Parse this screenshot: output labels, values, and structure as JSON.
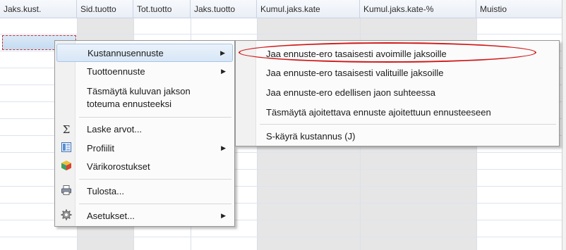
{
  "columns": [
    "Jaks.kust.",
    "Sid.tuotto",
    "Tot.tuotto",
    "Jaks.tuotto",
    "Kumul.jaks.kate",
    "Kumul.jaks.kate-%",
    "Muistio"
  ],
  "context_menu": {
    "items": [
      {
        "label": "Kustannusennuste",
        "icon": "",
        "submenu": true
      },
      {
        "label": "Tuottoennuste",
        "icon": "",
        "submenu": true
      },
      {
        "label": "Täsmäytä kuluvan jakson toteuma ennusteeksi",
        "line1": "Täsmäytä kuluvan jakson",
        "line2": "toteuma ennusteeksi",
        "icon": "",
        "submenu": false
      },
      {
        "label": "Laske arvot...",
        "icon": "sigma-icon",
        "submenu": false
      },
      {
        "label": "Profiilit",
        "icon": "profile-icon",
        "submenu": true
      },
      {
        "label": "Värikorostukset",
        "icon": "color-cube-icon",
        "submenu": false
      },
      {
        "label": "Tulosta...",
        "icon": "printer-icon",
        "submenu": false
      },
      {
        "label": "Asetukset...",
        "icon": "gear-icon",
        "submenu": true
      }
    ]
  },
  "submenu": {
    "items": [
      "Jaa ennuste-ero tasaisesti avoimille jaksoille",
      "Jaa ennuste-ero tasaisesti valituille jaksoille",
      "Jaa ennuste-ero edellisen jaon suhteessa",
      "Täsmäytä ajoitettava ennuste ajoitettuun ennusteeseen",
      "S-käyrä kustannus (J)"
    ]
  },
  "arrow_glyph": "▶",
  "sigma_glyph": "Σ"
}
